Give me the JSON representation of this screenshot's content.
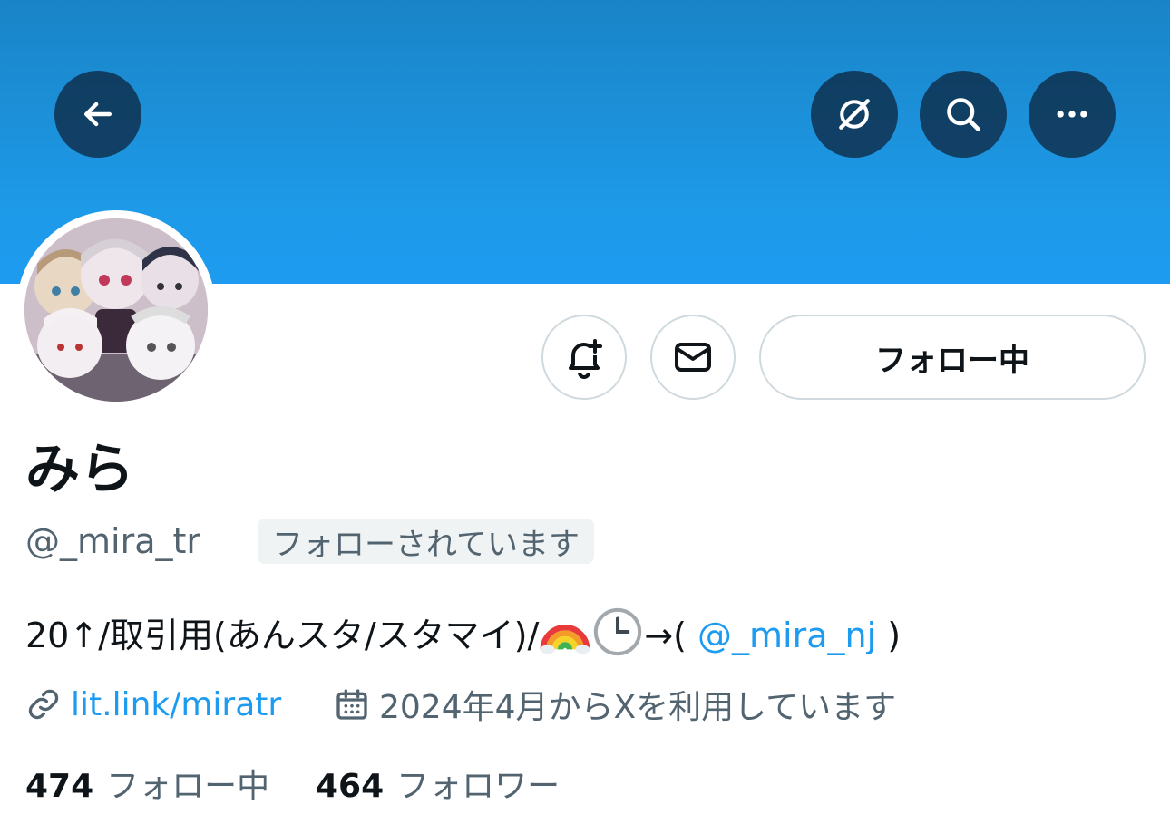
{
  "header": {
    "back_icon": "arrow-left-icon",
    "grok_icon": "grok-icon",
    "search_icon": "search-icon",
    "more_icon": "more-horizontal-icon",
    "banner_color": "#1d9bf0"
  },
  "actions": {
    "notify_icon": "bell-plus-icon",
    "message_icon": "envelope-icon",
    "following_label": "フォロー中"
  },
  "profile": {
    "display_name": "みら",
    "handle": "@_mira_tr",
    "follows_you_badge": "フォローされています",
    "bio_text": "20↑/取引用(あんスタ/スタマイ)/",
    "bio_arrow": "→(",
    "bio_mention": "@_mira_nj",
    "bio_close": ")",
    "website": "lit.link/miratr",
    "joined": "2024年4月からXを利用しています"
  },
  "stats": {
    "following_count": "474",
    "following_label": "フォロー中",
    "followers_count": "464",
    "followers_label": "フォロワー"
  },
  "colors": {
    "accent": "#1d9bf0",
    "secondary_text": "#536471",
    "primary_text": "#0f1419"
  }
}
